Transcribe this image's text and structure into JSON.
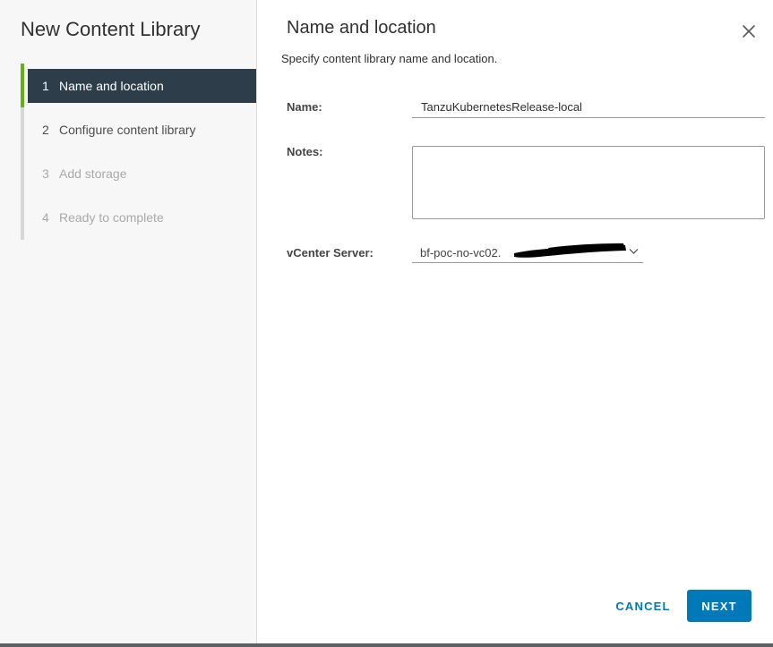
{
  "sidebar": {
    "title": "New Content Library",
    "steps": [
      {
        "num": "1",
        "label": "Name and location"
      },
      {
        "num": "2",
        "label": "Configure content library"
      },
      {
        "num": "3",
        "label": "Add storage"
      },
      {
        "num": "4",
        "label": "Ready to complete"
      }
    ]
  },
  "main": {
    "title": "Name and location",
    "subtitle": "Specify content library name and location.",
    "name_label": "Name:",
    "name_value": "TanzuKubernetesRelease-local",
    "notes_label": "Notes:",
    "notes_value": "",
    "vcenter_label": "vCenter Server:",
    "vcenter_value": "bf-poc-no-vc02."
  },
  "footer": {
    "cancel_label": "CANCEL",
    "next_label": "NEXT"
  },
  "icons": {
    "close": "close-icon",
    "dropdown": "chevron-down-icon"
  },
  "colors": {
    "accent": "#0079b8",
    "active_step_bg": "#2d3e4a",
    "active_step_bar": "#60b515"
  }
}
